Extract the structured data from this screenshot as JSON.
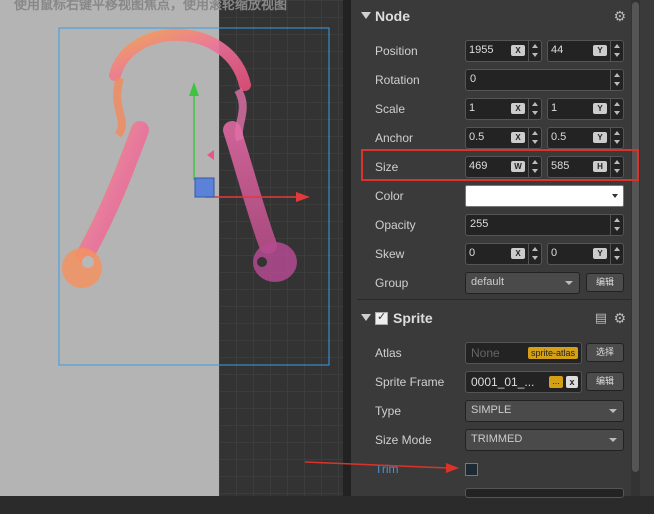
{
  "scene": {
    "hint": "使用鼠标右键平移视图焦点，使用滚轮缩放视图"
  },
  "node": {
    "title": "Node",
    "position": {
      "label": "Position",
      "x": "1955",
      "x_axis": "X",
      "y": "44",
      "y_axis": "Y"
    },
    "rotation": {
      "label": "Rotation",
      "value": "0"
    },
    "scale": {
      "label": "Scale",
      "x": "1",
      "x_axis": "X",
      "y": "1",
      "y_axis": "Y"
    },
    "anchor": {
      "label": "Anchor",
      "x": "0.5",
      "x_axis": "X",
      "y": "0.5",
      "y_axis": "Y"
    },
    "size": {
      "label": "Size",
      "w": "469",
      "w_axis": "W",
      "h": "585",
      "h_axis": "H"
    },
    "color": {
      "label": "Color",
      "value": "#ffffff"
    },
    "opacity": {
      "label": "Opacity",
      "value": "255"
    },
    "skew": {
      "label": "Skew",
      "x": "0",
      "x_axis": "X",
      "y": "0",
      "y_axis": "Y"
    },
    "group": {
      "label": "Group",
      "value": "default",
      "edit_button": "编辑"
    }
  },
  "sprite": {
    "title": "Sprite",
    "enabled": true,
    "atlas": {
      "label": "Atlas",
      "value": "None",
      "tag": "sprite-atlas",
      "select_button": "选择"
    },
    "sprite_frame": {
      "label": "Sprite Frame",
      "value": "0001_01_...",
      "dots": "...",
      "clear": "x",
      "edit_button": "编辑"
    },
    "type": {
      "label": "Type",
      "value": "SIMPLE"
    },
    "size_mode": {
      "label": "Size Mode",
      "value": "TRIMMED"
    },
    "trim": {
      "label": "Trim",
      "checked": false
    }
  },
  "colors": {
    "highlight": "#d9342b",
    "arrow": "#d9342b",
    "accent_tag": "#d4a017"
  }
}
